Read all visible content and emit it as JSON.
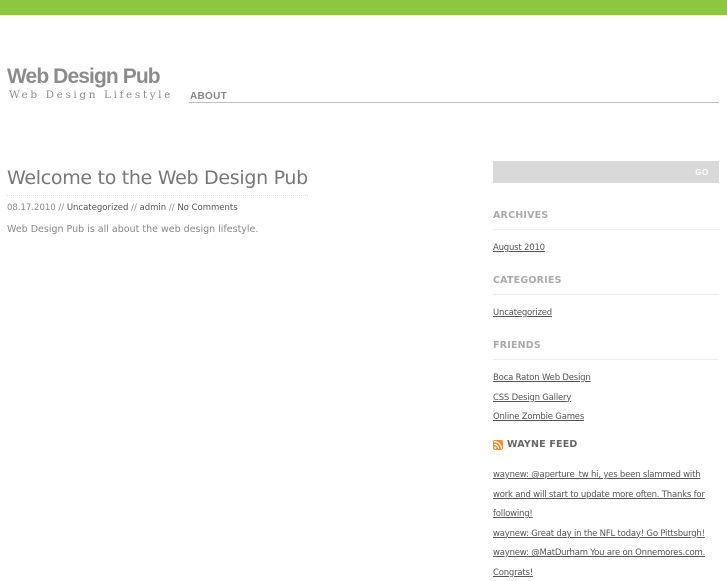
{
  "site": {
    "title": "Web Design Pub",
    "tagline": "Web Design Lifestyle"
  },
  "nav": {
    "items": [
      {
        "label": "ABOUT"
      }
    ]
  },
  "post": {
    "title": "Welcome to the Web Design Pub",
    "date": "08.17.2010",
    "category": "Uncategorized",
    "author": "admin",
    "comments": "No Comments",
    "separator": " // ",
    "body": "Web Design Pub is all about the web design lifestyle."
  },
  "search": {
    "placeholder": "",
    "value": "",
    "button_label": "GO"
  },
  "sidebar": {
    "archives": {
      "title": "ARCHIVES",
      "items": [
        "August 2010"
      ]
    },
    "categories": {
      "title": "CATEGORIES",
      "items": [
        "Uncategorized"
      ]
    },
    "friends": {
      "title": "FRIENDS",
      "items": [
        "Boca Raton Web Design",
        "CSS Design Gallery",
        "Online Zombie Games"
      ]
    },
    "feed": {
      "title": "WAYNE FEED",
      "icon": "rss-icon",
      "items": [
        "waynew: @aperture_tw hi, yes been slammed with work and will start to update more often. Thanks for following!",
        "waynew: Great day in the NFL today! Go Pittsburgh!",
        "waynew: @MatDurham You are on Onnemores.com. Congrats!"
      ]
    }
  },
  "colors": {
    "topbar": "#8dc63f",
    "logo": "#8c8c8c",
    "search_bg": "#d9d9d9",
    "rss": "#f08c2e"
  }
}
